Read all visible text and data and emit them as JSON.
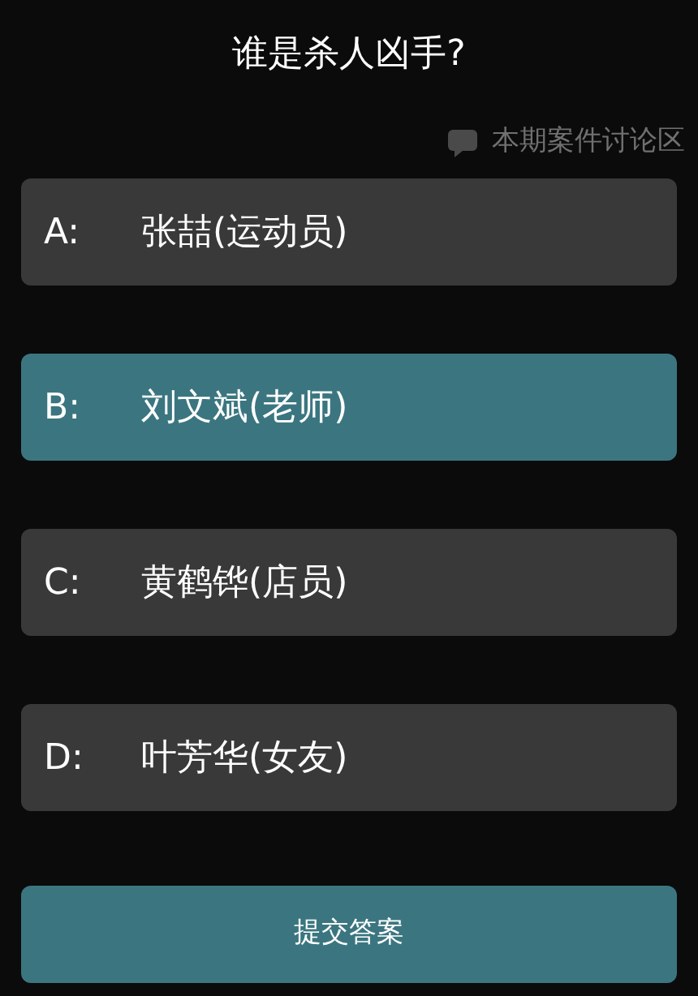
{
  "title": "谁是杀人凶手?",
  "discussion_link": {
    "label": "本期案件讨论区"
  },
  "options": [
    {
      "letter": "A:",
      "text": "张喆(运动员)",
      "selected": false
    },
    {
      "letter": "B:",
      "text": "刘文斌(老师)",
      "selected": true
    },
    {
      "letter": "C:",
      "text": "黄鹤铧(店员)",
      "selected": false
    },
    {
      "letter": "D:",
      "text": "叶芳华(女友)",
      "selected": false
    }
  ],
  "submit_button": {
    "label": "提交答案"
  }
}
